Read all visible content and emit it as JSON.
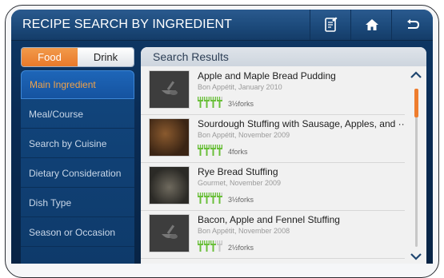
{
  "header": {
    "title": "RECIPE SEARCH BY INGREDIENT",
    "buttons": [
      {
        "icon": "shopping-list-icon"
      },
      {
        "icon": "home-icon"
      },
      {
        "icon": "back-icon"
      }
    ]
  },
  "segment": {
    "options": [
      "Food",
      "Drink"
    ],
    "selected": "Food"
  },
  "sidebar": {
    "items": [
      {
        "label": "Main Ingredient",
        "active": true
      },
      {
        "label": "Meal/Course"
      },
      {
        "label": "Search by Cuisine"
      },
      {
        "label": "Dietary Consideration"
      },
      {
        "label": "Dish Type"
      },
      {
        "label": "Season or Occasion"
      }
    ]
  },
  "results": {
    "heading": "Search Results",
    "items": [
      {
        "title": "Apple and Maple Bread Pudding",
        "source": "Bon Appétit, January 2010",
        "rating": 3.5,
        "rating_label": "3½forks",
        "image": "placeholder"
      },
      {
        "title": "Sourdough Stuffing with Sausage, Apples, and ···",
        "source": "Bon Appétit, November 2009",
        "rating": 4,
        "rating_label": "4forks",
        "image": "photo"
      },
      {
        "title": "Rye Bread Stuffing",
        "source": "Gourmet, November 2009",
        "rating": 3.5,
        "rating_label": "3½forks",
        "image": "photo"
      },
      {
        "title": "Bacon, Apple and Fennel Stuffing",
        "source": "Bon Appétit, November 2008",
        "rating": 2.5,
        "rating_label": "2½forks",
        "image": "placeholder"
      }
    ],
    "scroll": {
      "position": 0
    }
  },
  "colors": {
    "accent": "#ee7d2e",
    "fork_green": "#6abf3a",
    "fork_grey": "#c8c8c8",
    "panel": "#0f3a68"
  }
}
